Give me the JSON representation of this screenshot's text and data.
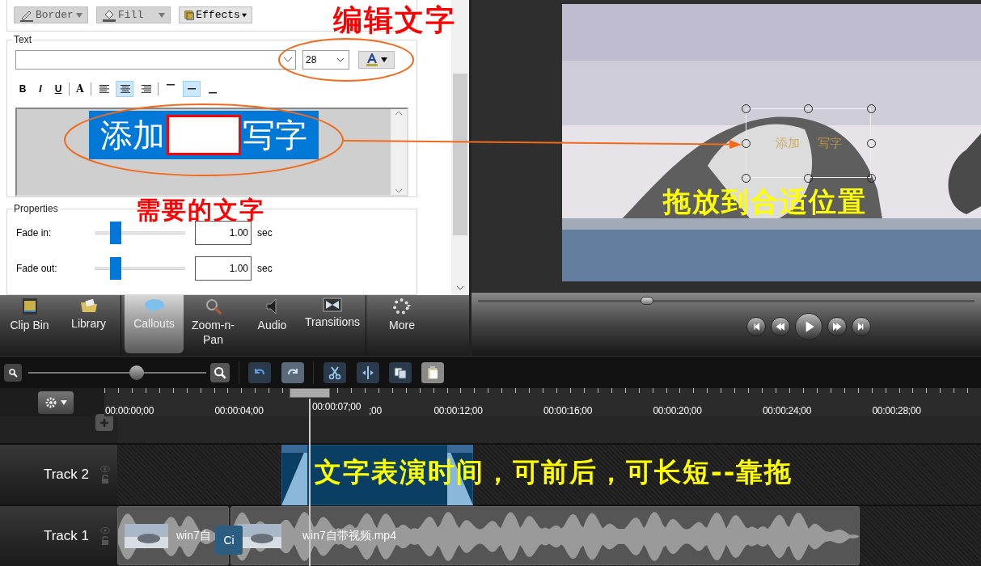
{
  "callout_toolbar": [
    {
      "kind": "border",
      "label": "Border"
    },
    {
      "kind": "fill",
      "label": "Fill"
    },
    {
      "kind": "effects",
      "label": "Effects"
    }
  ],
  "text_group": {
    "title": "Text",
    "font_size": "28",
    "format": [
      {
        "kind": "bold",
        "glyph": "B",
        "selected": false
      },
      {
        "kind": "italic",
        "glyph": "I",
        "selected": false
      },
      {
        "kind": "underline",
        "glyph": "U",
        "selected": false
      },
      {
        "kind": "outline",
        "glyph": "A",
        "selected": false
      }
    ],
    "alignment": [
      {
        "kind": "left",
        "selected": false
      },
      {
        "kind": "center",
        "selected": true
      },
      {
        "kind": "right",
        "selected": false
      }
    ],
    "vertical": [
      {
        "kind": "top",
        "selected": false
      },
      {
        "kind": "middle",
        "selected": true
      },
      {
        "kind": "bottom",
        "selected": false
      }
    ],
    "editor": {
      "before": "添加",
      "after": "写字"
    }
  },
  "properties": {
    "title": "Properties",
    "rows": [
      {
        "label": "Fade in:",
        "level": 0.23,
        "value": "1.00",
        "unit": "sec"
      },
      {
        "label": "Fade out:",
        "level": 0.23,
        "value": "1.00",
        "unit": "sec"
      }
    ]
  },
  "tabs": [
    {
      "kind": "clip-bin",
      "label": "Clip Bin",
      "selected": false
    },
    {
      "kind": "library",
      "label": "Library",
      "selected": false
    },
    {
      "kind": "callouts",
      "label": "Callouts",
      "selected": true
    },
    {
      "kind": "zoom",
      "label": "Zoom-n-Pan",
      "selected": false
    },
    {
      "kind": "audio",
      "label": "Audio",
      "selected": false
    },
    {
      "kind": "transitions",
      "label": "Transitions",
      "selected": false
    },
    {
      "kind": "more",
      "label": "More",
      "selected": false
    }
  ],
  "preview": {
    "caption_before": "添加",
    "caption_after": "写字",
    "scrub": {
      "level": 0.34
    }
  },
  "timeline": {
    "zoom": {
      "level": 0.61
    },
    "playhead_label": "00:00:07;00",
    "ticks": [
      "00:00:00;00",
      "00:00:04;00",
      ";00",
      "00:00:12;00",
      "00:00:16;00",
      "00:00:20;00",
      "00:00:24;00",
      "00:00:28;00"
    ],
    "tracks": [
      {
        "name": "Track 2",
        "clips": [
          {
            "kind": "callout"
          }
        ]
      },
      {
        "name": "Track 1",
        "marker": "Ci",
        "clips": [
          {
            "kind": "video",
            "label": "win7自"
          },
          {
            "kind": "video",
            "label": "win7自带视频.mp4"
          }
        ]
      }
    ]
  },
  "annotations": [
    {
      "text": "编辑文字",
      "color": "#ff0000"
    },
    {
      "text": "需要的文字",
      "color": "#ff0000"
    },
    {
      "text": "拖放到合适位置",
      "color": "#ffff00"
    },
    {
      "text": "文字表演时间，可前后，可长短--靠拖",
      "color": "#ffff00"
    }
  ]
}
